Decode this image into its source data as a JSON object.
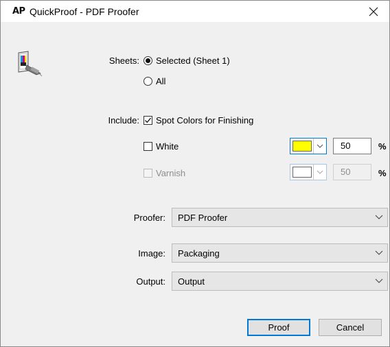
{
  "titlebar": {
    "logo": "AP",
    "title": "QuickProof - PDF Proofer",
    "close_glyph": "✕"
  },
  "sheets": {
    "label": "Sheets:",
    "options": [
      {
        "label": "Selected (Sheet 1)",
        "selected": true
      },
      {
        "label": "All",
        "selected": false
      }
    ]
  },
  "include": {
    "label": "Include:",
    "spot_colors": {
      "label": "Spot Colors for Finishing",
      "checked": true
    },
    "white": {
      "label": "White",
      "checked": false,
      "color": "#ffff00",
      "percent": "50",
      "unit": "%"
    },
    "varnish": {
      "label": "Varnish",
      "checked": false,
      "enabled": false,
      "color": "#ffffff",
      "percent": "50",
      "unit": "%"
    }
  },
  "proofer": {
    "label": "Proofer:",
    "value": "PDF Proofer"
  },
  "image": {
    "label": "Image:",
    "value": "Packaging"
  },
  "output": {
    "label": "Output:",
    "value": "Output"
  },
  "buttons": {
    "proof": "Proof",
    "cancel": "Cancel"
  },
  "icons": {
    "dialog_icon": "printer-proof-icon",
    "check": "checkmark-icon",
    "dropdown": "chevron-down-icon",
    "close": "close-icon"
  }
}
